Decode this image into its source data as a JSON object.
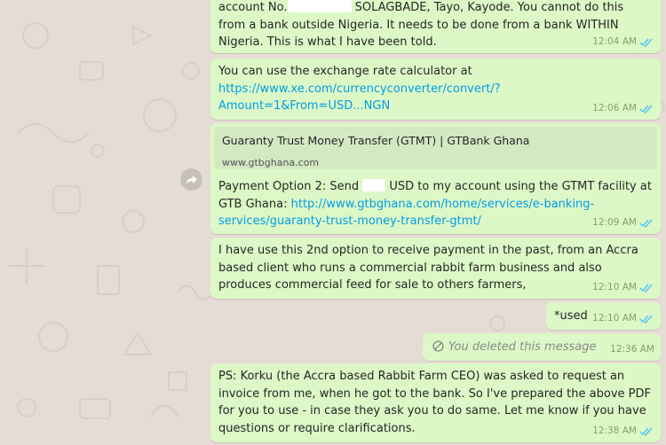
{
  "colors": {
    "outgoing_bubble": "#dcf8c6",
    "wallpaper": "#e5ddd5",
    "link": "#039be5",
    "read_ticks": "#4fc3f7"
  },
  "messages": [
    {
      "text_part1": "account No.",
      "text_part2": " SOLAGBADE, Tayo, Kayode. You cannot do this from a bank outside Nigeria. It needs to be done from a bank WITHIN Nigeria. This is what I have been told.",
      "time": "12:04 AM"
    },
    {
      "text": "You can use the exchange rate calculator at ",
      "link": "https://www.xe.com/currencyconverter/convert/?Amount=1&From=USD...NGN",
      "time": "12:06 AM"
    },
    {
      "preview_title": "Guaranty Trust Money Transfer (GTMT) | GTBank Ghana",
      "preview_url": "www.gtbghana.com",
      "text_part1": "Payment Option 2: Send ",
      "text_part2": " USD to my account using the GTMT facility at GTB Ghana: ",
      "link": "http://www.gtbghana.com/home/services/e-banking-services/guaranty-trust-money-transfer-gtmt/",
      "time": "12:09 AM"
    },
    {
      "text": "I have use this 2nd option to receive payment in the past, from an Accra based client who runs a commercial rabbit farm business and also produces commercial feed for sale to others farmers,",
      "time": "12:10 AM"
    },
    {
      "text": "*used",
      "time": "12:10 AM"
    },
    {
      "text": "You deleted this message",
      "time": "12:36 AM"
    },
    {
      "text": "PS: Korku (the Accra based Rabbit Farm CEO) was asked to request an invoice from me, when he got to the bank. So I've prepared the above PDF for you to use - in case they ask you to do same. Let me know if you have questions or require clarifications.",
      "time": "12:38 AM"
    }
  ]
}
